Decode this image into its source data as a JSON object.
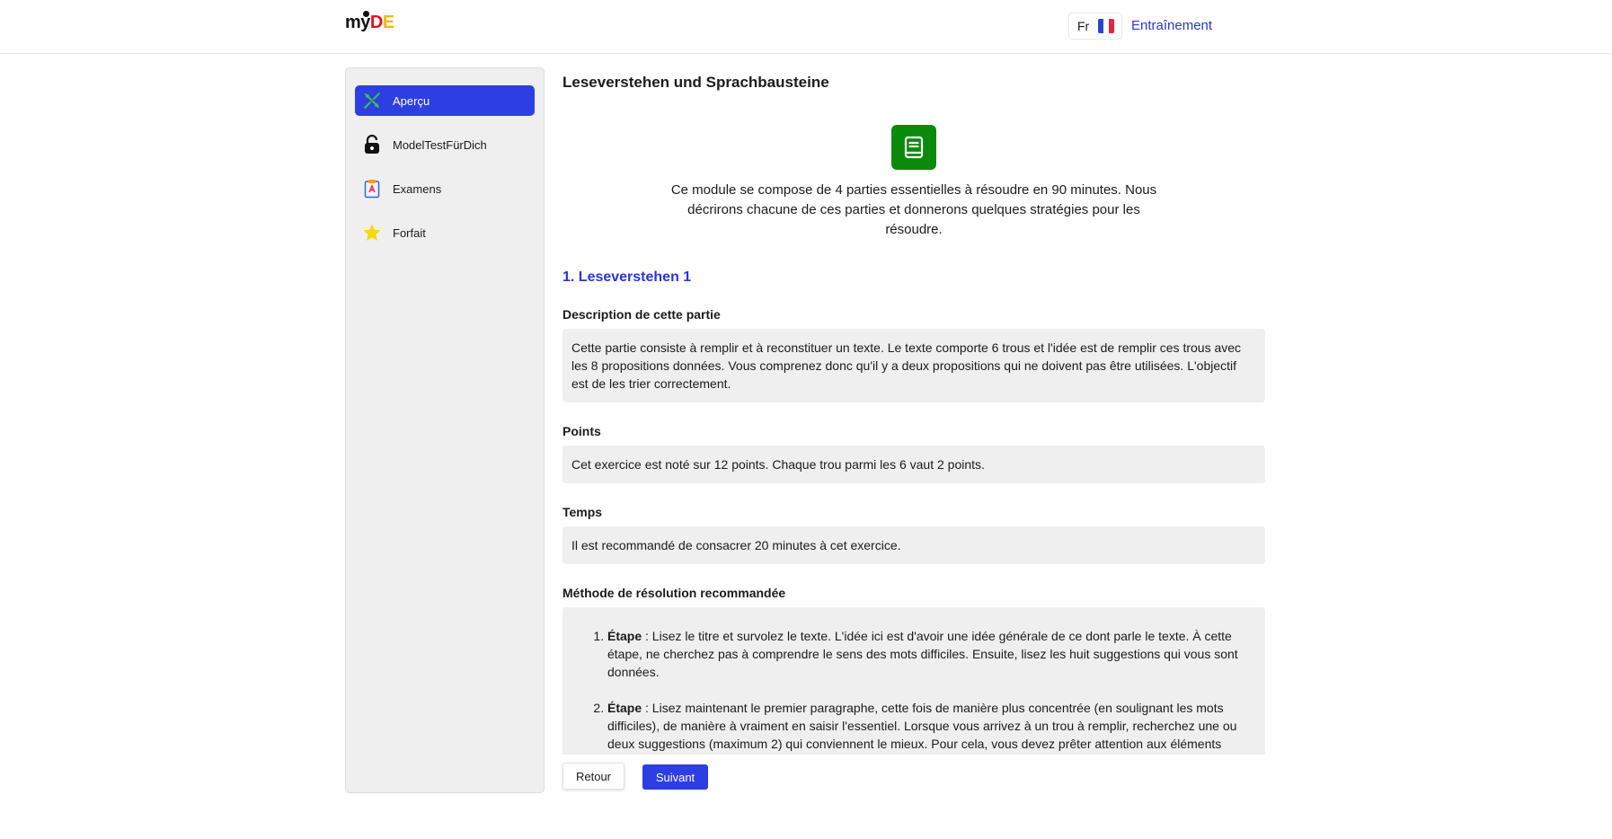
{
  "header": {
    "logo": {
      "part1": "my",
      "part2": "D",
      "part3": "E"
    },
    "language": {
      "code": "Fr",
      "flag_icon": "france-flag-icon"
    },
    "nav_link": "Entraînement"
  },
  "sidebar": {
    "items": [
      {
        "label": "Aperçu",
        "icon": "overview-icon",
        "active": true
      },
      {
        "label": "ModelTestFürDich",
        "icon": "lock-icon",
        "active": false
      },
      {
        "label": "Examens",
        "icon": "exam-clipboard-icon",
        "active": false
      },
      {
        "label": "Forfait",
        "icon": "star-icon",
        "active": false
      }
    ]
  },
  "main": {
    "title": "Leseverstehen und Sprachbausteine",
    "module_icon": "book-icon",
    "intro": "Ce module se compose de 4 parties essentielles à résoudre en 90 minutes. Nous décrirons chacune de ces parties et donnerons quelques stratégies pour les résoudre.",
    "section_title": "1. Leseverstehen 1",
    "description": {
      "heading": "Description de cette partie",
      "text": "Cette partie consiste à remplir et à reconstituer un texte. Le texte comporte 6 trous et l'idée est de remplir ces trous avec les 8 propositions données. Vous comprenez donc qu'il y a deux propositions qui ne doivent pas être utilisées. L'objectif est de les trier correctement."
    },
    "points": {
      "heading": "Points",
      "text": "Cet exercice est noté sur 12 points. Chaque trou parmi les 6 vaut 2 points."
    },
    "time": {
      "heading": "Temps",
      "text": "Il est recommandé de consacrer 20 minutes à cet exercice."
    },
    "method": {
      "heading": "Méthode de résolution recommandée",
      "steps": [
        {
          "label": "Étape",
          "text": " : Lisez le titre et survolez le texte. L'idée ici est d'avoir une idée générale de ce dont parle le texte. À cette étape, ne cherchez pas à comprendre le sens des mots difficiles. Ensuite, lisez les huit suggestions qui vous sont données."
        },
        {
          "label": "Étape",
          "text": " : Lisez maintenant le premier paragraphe, cette fois de manière plus concentrée (en soulignant les mots difficiles), de manière à vraiment en saisir l'essentiel. Lorsque vous arrivez à un trou à remplir, recherchez une ou deux suggestions (maximum 2) qui conviennent le mieux. Pour cela, vous devez prêter attention aux éléments suivants :"
        }
      ]
    }
  },
  "footer": {
    "back_label": "Retour",
    "next_label": "Suivant"
  },
  "colors": {
    "accent": "#2d3ee3",
    "module_green": "#0c8a0c",
    "box_bg": "#efefef"
  }
}
